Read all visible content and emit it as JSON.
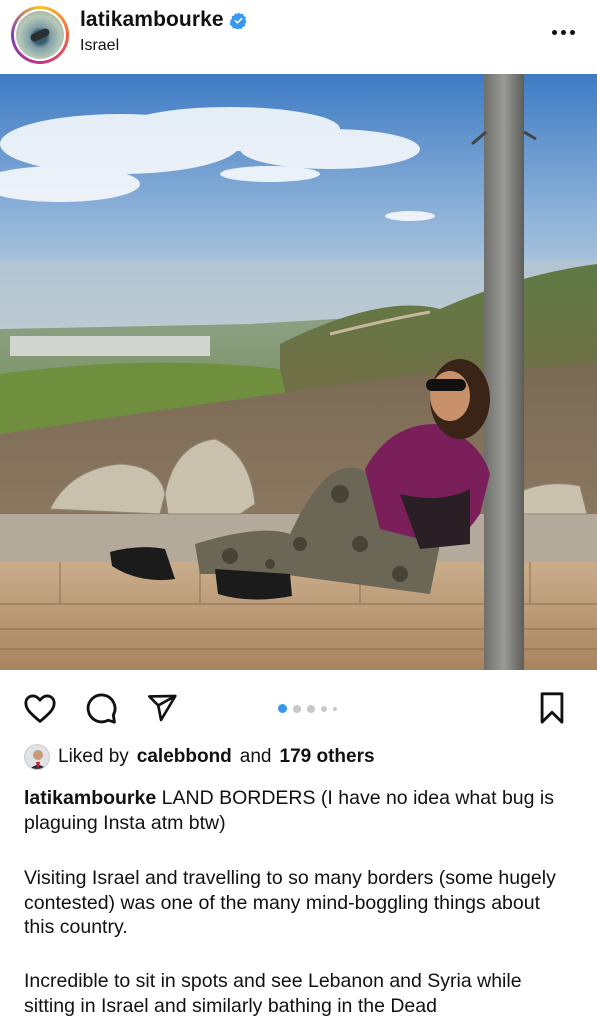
{
  "post": {
    "username": "latikambourke",
    "location": "Israel"
  },
  "carousel": {
    "total": 5,
    "active": 1
  },
  "likes": {
    "prefix": "Liked by",
    "user": "calebbond",
    "joiner": "and",
    "others": "179 others"
  },
  "caption": {
    "username": "latikambourke",
    "text": "LAND BORDERS (I have no idea what bug is plaguing Insta atm btw)",
    "paragraph2": "Visiting Israel and travelling to so many borders (some hugely contested) was one of the many mind-boggling things about this country.",
    "paragraph3": "Incredible to sit in spots and see Lebanon and Syria while sitting in Israel and similarly bathing in the Dead"
  },
  "colors": {
    "active_dot": "#3897f0",
    "verified": "#3897f0"
  },
  "icons": [
    "verified-icon",
    "more-options-icon",
    "heart-icon",
    "comment-icon",
    "share-icon",
    "bookmark-icon"
  ]
}
